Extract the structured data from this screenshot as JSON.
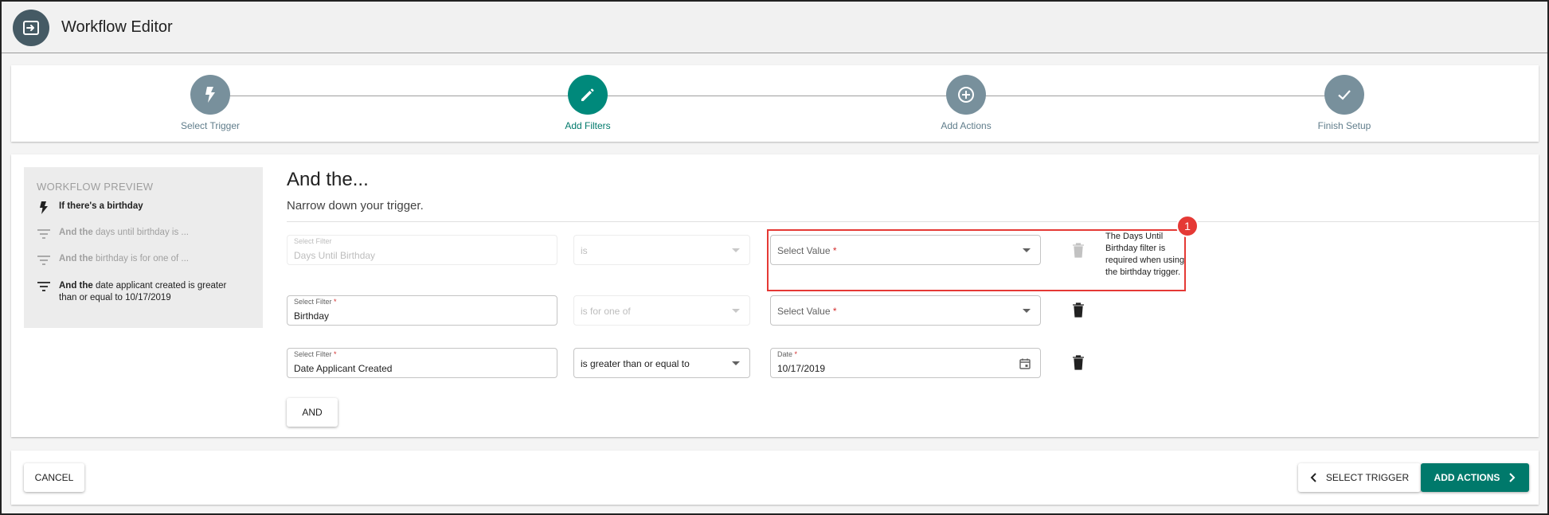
{
  "app": {
    "title": "Workflow Editor"
  },
  "stepper": {
    "steps": [
      {
        "label": "Select Trigger",
        "icon": "bolt-icon",
        "state": "done"
      },
      {
        "label": "Add Filters",
        "icon": "pencil-icon",
        "state": "active"
      },
      {
        "label": "Add Actions",
        "icon": "plus-circle-icon",
        "state": "todo"
      },
      {
        "label": "Finish Setup",
        "icon": "check-icon",
        "state": "todo"
      }
    ],
    "colors": {
      "inactive": "#78909c",
      "active": "#00897b"
    }
  },
  "preview": {
    "title": "WORKFLOW PREVIEW",
    "items": [
      {
        "bold": "If there's a birthday",
        "rest": ""
      },
      {
        "bold": "And the",
        "rest": " days until birthday is ..."
      },
      {
        "bold": "And the",
        "rest": " birthday is for one of ..."
      },
      {
        "bold": "And the",
        "rest": " date applicant created is greater than or equal to 10/17/2019"
      }
    ]
  },
  "main": {
    "heading": "And the...",
    "subheading": "Narrow down your trigger.",
    "rows": [
      {
        "filter_label": "Select Filter",
        "filter_value": "Days Until Birthday",
        "operator_value": "is",
        "value_placeholder": "Select Value",
        "required_mark": "*"
      },
      {
        "filter_label": "Select Filter",
        "filter_value": "Birthday",
        "operator_value": "is for one of",
        "value_placeholder": "Select Value",
        "required_mark": "*"
      },
      {
        "filter_label": "Select Filter",
        "filter_value": "Date Applicant Created",
        "operator_value": "is greater than or equal to",
        "value_label": "Date",
        "value_value": "10/17/2019",
        "required_mark": "*"
      }
    ],
    "and_button": "AND",
    "hint": "The Days Until Birthday filter is required when using the birthday trigger.",
    "annotation_badge": "1"
  },
  "footer": {
    "cancel": "CANCEL",
    "prev": "SELECT TRIGGER",
    "next": "ADD ACTIONS"
  },
  "colors": {
    "accent": "#00796b",
    "highlight": "#e53935",
    "appbar_icon": "#455a64"
  }
}
